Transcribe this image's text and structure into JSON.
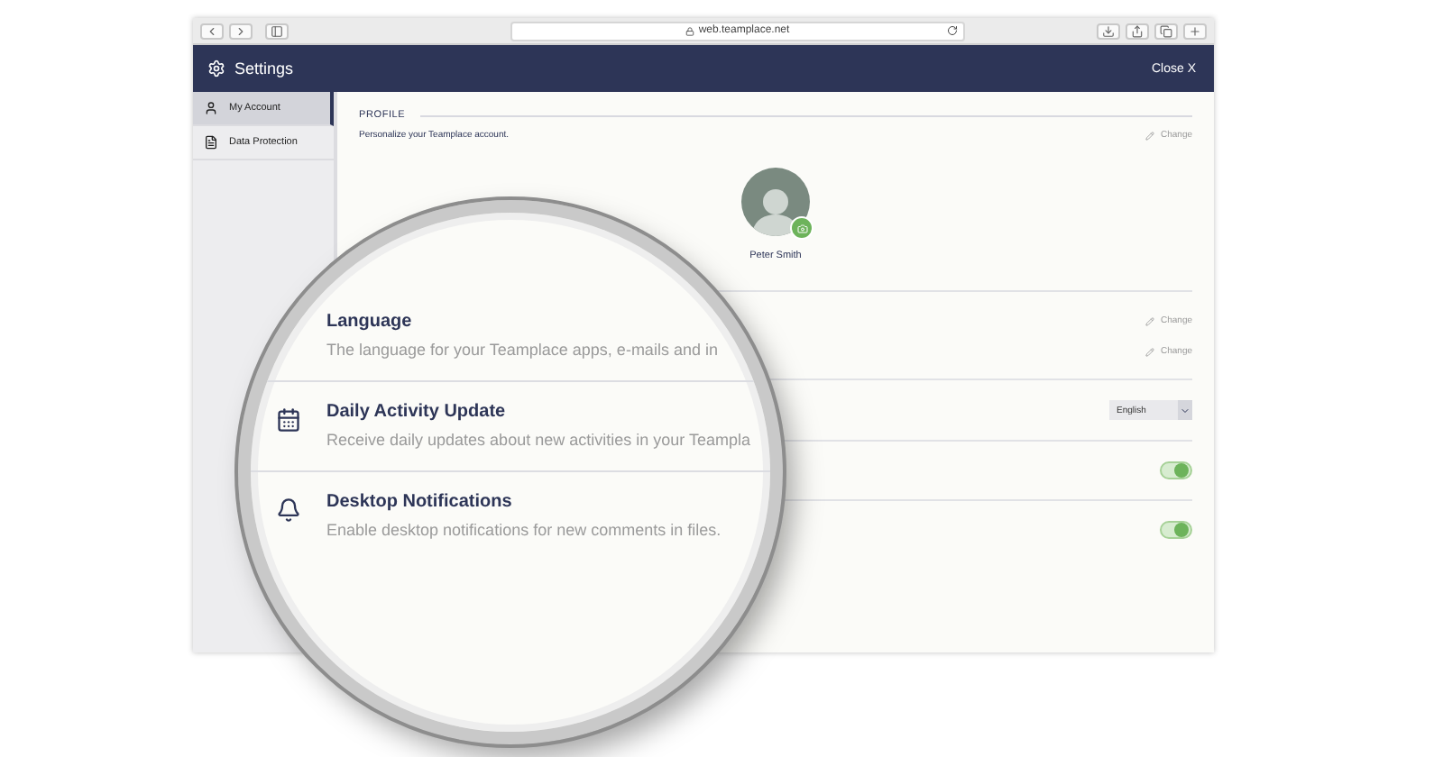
{
  "browser": {
    "url": "web.teamplace.net"
  },
  "header": {
    "title": "Settings",
    "close": "Close X"
  },
  "sidebar": {
    "items": [
      {
        "label": "My Account",
        "selected": true
      },
      {
        "label": "Data Protection",
        "selected": false
      }
    ]
  },
  "profile": {
    "heading": "PROFILE",
    "subtitle": "Personalize your Teamplace account.",
    "action": "Change",
    "name": "Peter Smith"
  },
  "account_rows": [
    {
      "action": "Change"
    },
    {
      "action": "Change"
    }
  ],
  "settings": [
    {
      "kind": "select",
      "title": "Language",
      "description": "The language for your Teamplace apps, e-mails and in",
      "value": "English"
    },
    {
      "kind": "toggle",
      "title": "Daily Activity Update",
      "description": "Receive daily updates about new activities in your Teampla",
      "on": true
    },
    {
      "kind": "toggle",
      "title": "Desktop Notifications",
      "description": "Enable desktop notifications for new comments in files.",
      "on": true
    }
  ]
}
